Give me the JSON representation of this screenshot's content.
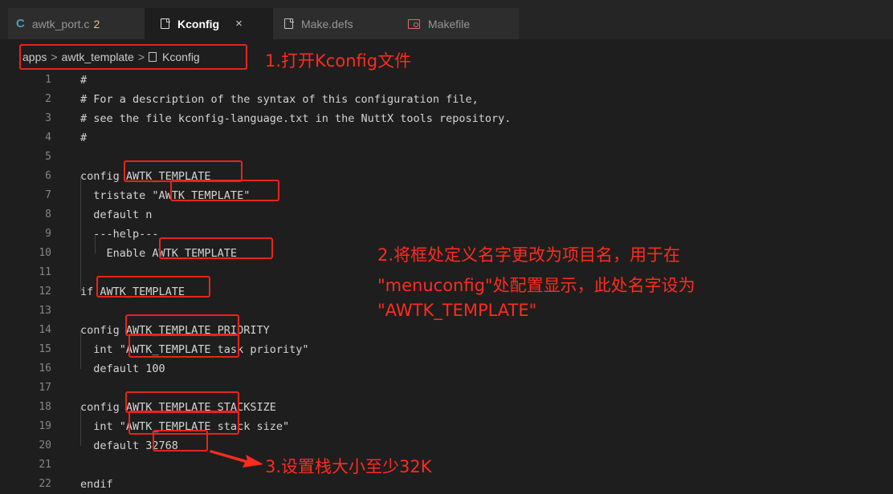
{
  "tabs": [
    {
      "label": "awtk_port.c",
      "badge": "2",
      "icon": "c-file-icon",
      "active": false
    },
    {
      "label": "Kconfig",
      "icon": "file-icon",
      "active": true,
      "close": "×"
    },
    {
      "label": "Make.defs",
      "icon": "file-icon",
      "active": false
    },
    {
      "label": "Makefile",
      "icon": "makefile-icon",
      "active": false
    }
  ],
  "breadcrumb": {
    "items": [
      "apps",
      "awtk_template",
      "Kconfig"
    ],
    "separator": ">"
  },
  "code": {
    "lines": [
      {
        "num": "1",
        "text": "#"
      },
      {
        "num": "2",
        "text": "# For a description of the syntax of this configuration file,"
      },
      {
        "num": "3",
        "text": "# see the file kconfig-language.txt in the NuttX tools repository."
      },
      {
        "num": "4",
        "text": "#"
      },
      {
        "num": "5",
        "text": ""
      },
      {
        "num": "6",
        "text": "config AWTK_TEMPLATE"
      },
      {
        "num": "7",
        "text": "  tristate \"AWTK_TEMPLATE\""
      },
      {
        "num": "8",
        "text": "  default n"
      },
      {
        "num": "9",
        "text": "  ---help---"
      },
      {
        "num": "10",
        "text": "    Enable AWTK_TEMPLATE"
      },
      {
        "num": "11",
        "text": ""
      },
      {
        "num": "12",
        "text": "if AWTK_TEMPLATE"
      },
      {
        "num": "13",
        "text": ""
      },
      {
        "num": "14",
        "text": "config AWTK_TEMPLATE_PRIORITY"
      },
      {
        "num": "15",
        "text": "  int \"AWTK_TEMPLATE task priority\""
      },
      {
        "num": "16",
        "text": "  default 100"
      },
      {
        "num": "17",
        "text": ""
      },
      {
        "num": "18",
        "text": "config AWTK_TEMPLATE_STACKSIZE"
      },
      {
        "num": "19",
        "text": "  int \"AWTK_TEMPLATE stack size\""
      },
      {
        "num": "20",
        "text": "  default 32768"
      },
      {
        "num": "21",
        "text": ""
      },
      {
        "num": "22",
        "text": "endif"
      }
    ]
  },
  "annotations": {
    "step1": "1.打开Kconfig文件",
    "step2_line1": "2.将框处定义名字更改为项目名，用于在",
    "step2_line2": "\"menuconfig\"处配置显示，此处名字设为",
    "step2_line3": "\"AWTK_TEMPLATE\"",
    "step3": "3.设置栈大小至少32K"
  },
  "colors": {
    "editor_bg": "#1e1e1e",
    "tabbar_bg": "#252526",
    "highlight": "#e8241c",
    "annotation": "#ff2b1f"
  }
}
